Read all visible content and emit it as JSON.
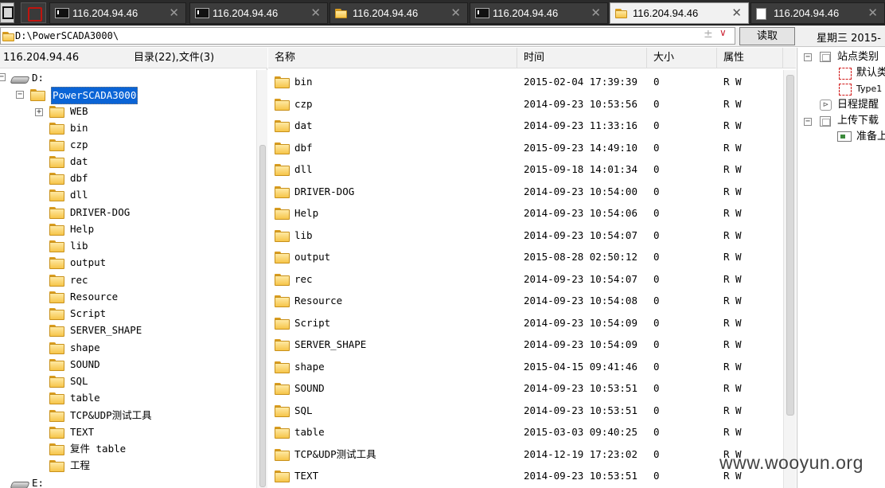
{
  "tabs": [
    {
      "label": "116.204.94.46",
      "icon": "terminal-icon",
      "active": false
    },
    {
      "label": "116.204.94.46",
      "icon": "terminal-icon",
      "active": false
    },
    {
      "label": "116.204.94.46",
      "icon": "folder-icon",
      "active": false
    },
    {
      "label": "116.204.94.46",
      "icon": "terminal-icon",
      "active": false
    },
    {
      "label": "116.204.94.46",
      "icon": "folder-icon",
      "active": true
    },
    {
      "label": "116.204.94.46",
      "icon": "document-icon",
      "active": false
    }
  ],
  "tab_close_symbol": "✕",
  "pathbar": {
    "path": "D:\\PowerSCADA3000\\",
    "plus_symbol": "±",
    "dropdown_symbol": "∨",
    "read_button": "读取",
    "weekday": "星期三 2015-"
  },
  "tree": {
    "host": "116.204.94.46",
    "count_label": "目录(22),文件(3)",
    "drive_d": "D:",
    "drive_e": "E:",
    "root_folder": "PowerSCADA3000",
    "items": [
      "WEB",
      "bin",
      "czp",
      "dat",
      "dbf",
      "dll",
      "DRIVER-DOG",
      "Help",
      "lib",
      "output",
      "rec",
      "Resource",
      "Script",
      "SERVER_SHAPE",
      "shape",
      "SOUND",
      "SQL",
      "table",
      "TCP&UDP测试工具",
      "TEXT",
      "复件 table",
      "工程"
    ]
  },
  "list": {
    "columns": {
      "name": "名称",
      "time": "时间",
      "size": "大小",
      "attr": "属性"
    },
    "rows": [
      {
        "name": "bin",
        "time": "2015-02-04 17:39:39",
        "size": "0",
        "attr": "R W"
      },
      {
        "name": "czp",
        "time": "2014-09-23 10:53:56",
        "size": "0",
        "attr": "R W"
      },
      {
        "name": "dat",
        "time": "2014-09-23 11:33:16",
        "size": "0",
        "attr": "R W"
      },
      {
        "name": "dbf",
        "time": "2015-09-23 14:49:10",
        "size": "0",
        "attr": "R W"
      },
      {
        "name": "dll",
        "time": "2015-09-18 14:01:34",
        "size": "0",
        "attr": "R W"
      },
      {
        "name": "DRIVER-DOG",
        "time": "2014-09-23 10:54:00",
        "size": "0",
        "attr": "R W"
      },
      {
        "name": "Help",
        "time": "2014-09-23 10:54:06",
        "size": "0",
        "attr": "R W"
      },
      {
        "name": "lib",
        "time": "2014-09-23 10:54:07",
        "size": "0",
        "attr": "R W"
      },
      {
        "name": "output",
        "time": "2015-08-28 02:50:12",
        "size": "0",
        "attr": "R W"
      },
      {
        "name": "rec",
        "time": "2014-09-23 10:54:07",
        "size": "0",
        "attr": "R W"
      },
      {
        "name": "Resource",
        "time": "2014-09-23 10:54:08",
        "size": "0",
        "attr": "R W"
      },
      {
        "name": "Script",
        "time": "2014-09-23 10:54:09",
        "size": "0",
        "attr": "R W"
      },
      {
        "name": "SERVER_SHAPE",
        "time": "2014-09-23 10:54:09",
        "size": "0",
        "attr": "R W"
      },
      {
        "name": "shape",
        "time": "2015-04-15 09:41:46",
        "size": "0",
        "attr": "R W"
      },
      {
        "name": "SOUND",
        "time": "2014-09-23 10:53:51",
        "size": "0",
        "attr": "R W"
      },
      {
        "name": "SQL",
        "time": "2014-09-23 10:53:51",
        "size": "0",
        "attr": "R W"
      },
      {
        "name": "table",
        "time": "2015-03-03 09:40:25",
        "size": "0",
        "attr": "R W"
      },
      {
        "name": "TCP&UDP测试工具",
        "time": "2014-12-19 17:23:02",
        "size": "0",
        "attr": "R W"
      },
      {
        "name": "TEXT",
        "time": "2014-09-23 10:53:51",
        "size": "0",
        "attr": "R W"
      }
    ]
  },
  "right_panel": {
    "site_category": "站点类别",
    "default_item": "默认类",
    "type_item": "Type1",
    "schedule": "日程提醒",
    "upload_download": "上传下载",
    "ready": "准备上"
  },
  "watermark": "www.wooyun.org"
}
